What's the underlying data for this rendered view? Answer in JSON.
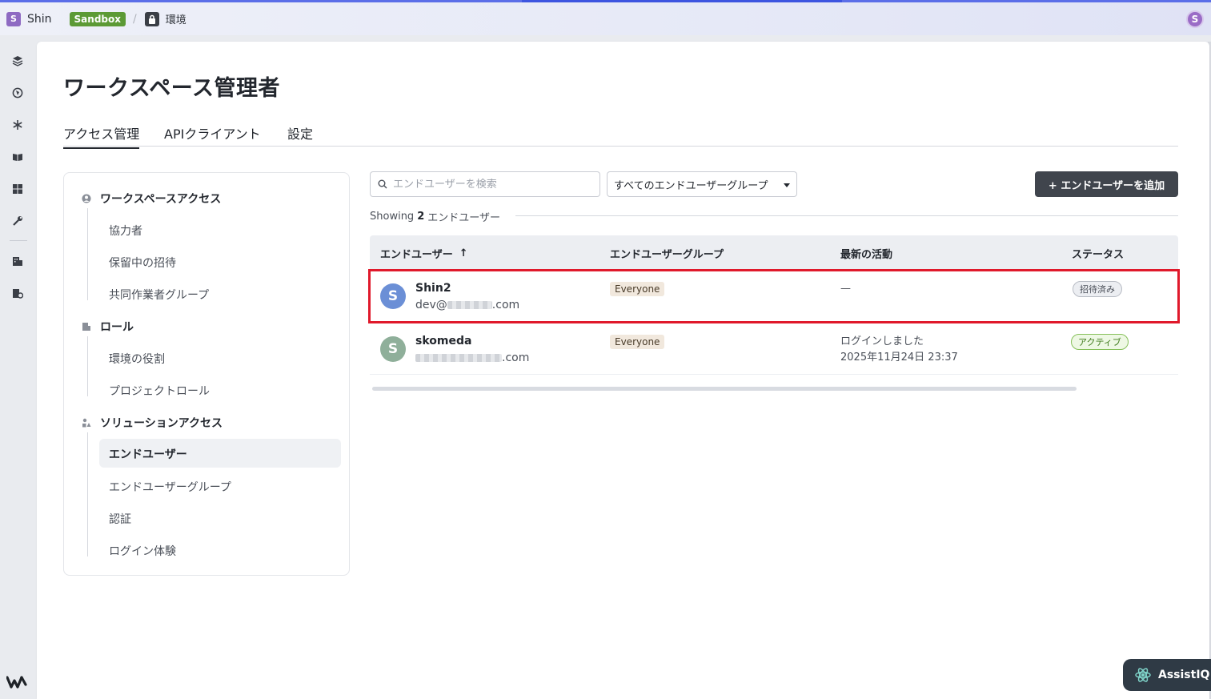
{
  "topbar": {
    "workspace_initial": "S",
    "workspace_name": "Shin",
    "env_badge": "Sandbox",
    "separator": "/",
    "env_name": "環境",
    "user_initial": "S"
  },
  "page": {
    "title": "ワークスペース管理者"
  },
  "tabs": [
    {
      "label": "アクセス管理",
      "active": true
    },
    {
      "label": "APIクライアント",
      "active": false
    },
    {
      "label": "設定",
      "active": false
    }
  ],
  "nav": {
    "workspace_access": {
      "label": "ワークスペースアクセス",
      "items": [
        "協力者",
        "保留中の招待",
        "共同作業者グループ"
      ]
    },
    "roles": {
      "label": "ロール",
      "items": [
        "環境の役割",
        "プロジェクトロール"
      ]
    },
    "solution_access": {
      "label": "ソリューションアクセス",
      "items": [
        "エンドユーザー",
        "エンドユーザーグループ",
        "認証",
        "ログイン体験"
      ],
      "active_item": "エンドユーザー"
    }
  },
  "toolbar": {
    "search_placeholder": "エンドユーザーを検索",
    "group_filter": "すべてのエンドユーザーグループ",
    "add_button": "+ エンドユーザーを追加"
  },
  "showing": {
    "prefix": "Showing",
    "count": "2",
    "suffix": "エンドユーザー"
  },
  "table": {
    "columns": [
      "エンドユーザー",
      "エンドユーザーグループ",
      "最新の活動",
      "ステータス"
    ],
    "sort_indicator": "↑",
    "rows": [
      {
        "initial": "S",
        "name": "Shin2",
        "email_prefix": "dev@",
        "email_suffix": ".com",
        "group": "Everyone",
        "activity_line1": "—",
        "activity_line2": "",
        "status": "招待済み",
        "avatar_color": "#6b8fd6"
      },
      {
        "initial": "S",
        "name": "skomeda",
        "email_prefix": "",
        "email_suffix": ".com",
        "group": "Everyone",
        "activity_line1": "ログインしました",
        "activity_line2": "2025年11月24日 23:37",
        "status": "アクティブ",
        "avatar_color": "#8faf9a"
      }
    ]
  },
  "assist": {
    "label": "AssistIQ"
  },
  "rail_icons": [
    "layers-icon",
    "globe-icon",
    "asterisk-icon",
    "book-icon",
    "grid-icon",
    "wrench-icon",
    "building-icon",
    "building-gear-icon"
  ],
  "colors": {
    "sandbox_green": "#5c9a35",
    "highlight_red": "#e0192b",
    "primary_button": "#40454d"
  }
}
